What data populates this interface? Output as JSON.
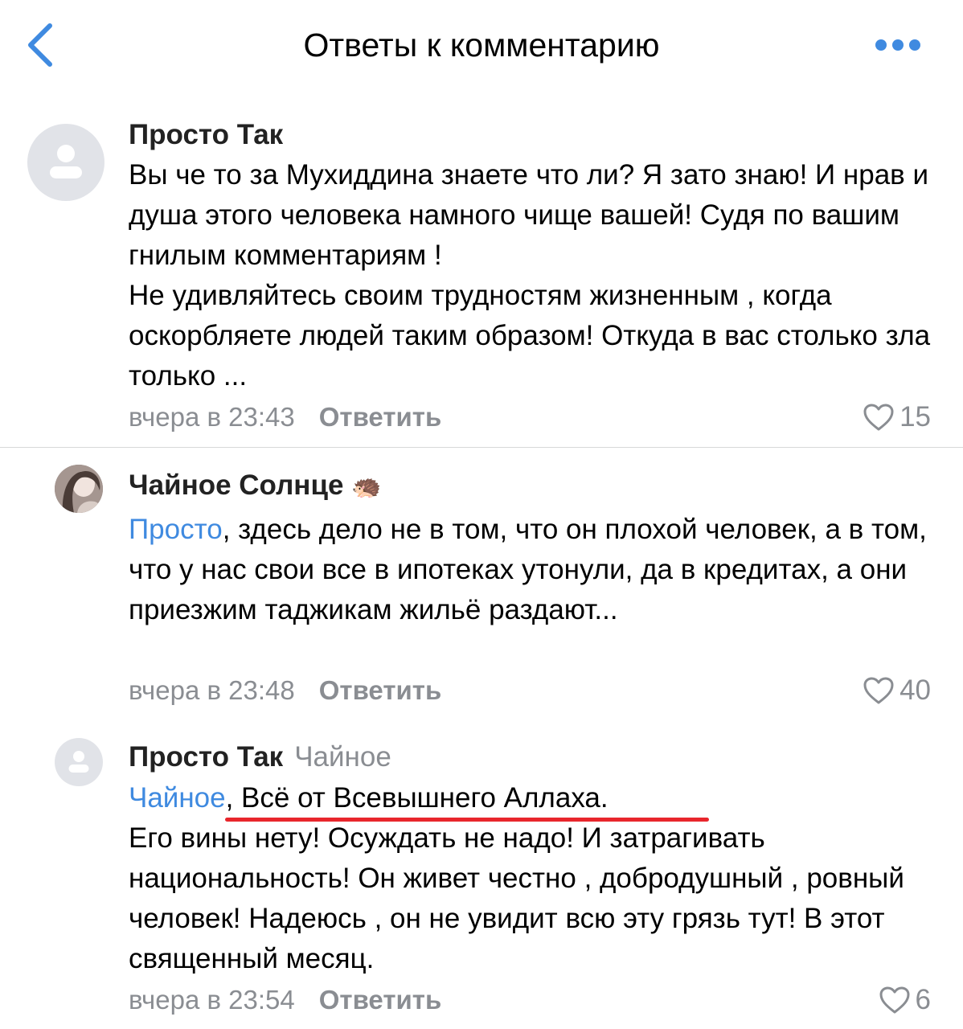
{
  "header": {
    "title": "Ответы к комментарию",
    "back_icon": "chevron-left-icon",
    "more_icon": "more-horizontal-icon",
    "accent": "#3f8ae0"
  },
  "comments": [
    {
      "author": "Просто Так",
      "text_lines": [
        "Вы че то за Мухиддина знаете что ли? Я зато знаю! И нрав и душа этого человека намного чище вашей! Судя по вашим гнилым комментариям !",
        "Не удивляйтесь своим трудностям жизненным , когда оскорбляете людей таким образом! Откуда в вас столько зла только ..."
      ],
      "time": "вчера в 23:43",
      "reply_label": "Ответить",
      "likes": "15"
    },
    {
      "author": "Чайное Солнце",
      "author_emoji": "🦔",
      "mention": "Просто",
      "text": ", здесь дело не в том, что он плохой человек, а в том, что у нас свои все в ипотеках утонули, да в кредитах, а они приезжим таджикам жильё раздают...",
      "time": "вчера в 23:48",
      "reply_label": "Ответить",
      "likes": "40"
    },
    {
      "author": "Просто Так",
      "reply_to": "Чайное",
      "mention": "Чайное",
      "first_line": ", Всё от Всевышнего Аллаха.",
      "text": "Его вины нету! Осуждать не надо! И затрагивать национальность! Он живет честно , добродушный , ровный человек! Надеюсь , он не увидит всю эту грязь тут! В этот священный месяц.",
      "time": "вчера в 23:54",
      "reply_label": "Ответить",
      "likes": "6",
      "highlight_color": "#e8262c"
    }
  ]
}
